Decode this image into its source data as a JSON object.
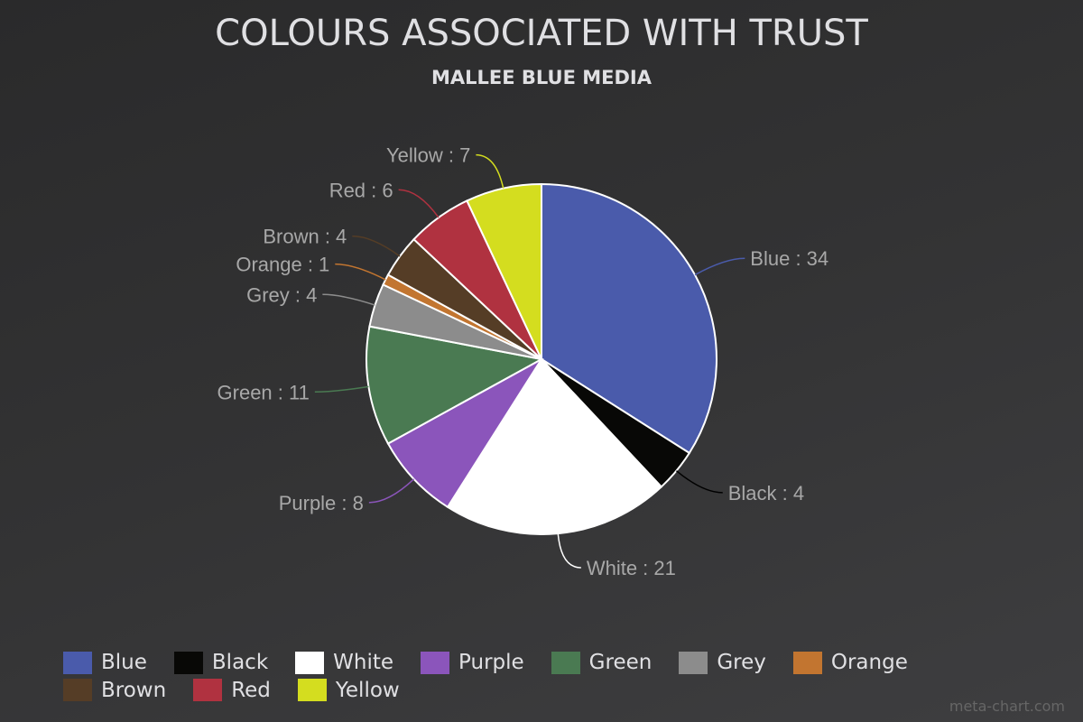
{
  "chart_data": {
    "type": "pie",
    "title": "COLOURS ASSOCIATED WITH TRUST",
    "subtitle": "MALLEE BLUE MEDIA",
    "categories": [
      "Blue",
      "Black",
      "White",
      "Purple",
      "Green",
      "Grey",
      "Orange",
      "Brown",
      "Red",
      "Yellow"
    ],
    "values": [
      34,
      4,
      21,
      8,
      11,
      4,
      1,
      4,
      6,
      7
    ],
    "colors": [
      "#4a5bab",
      "#080806",
      "#ffffff",
      "#8b55bb",
      "#4a7a52",
      "#8c8c8c",
      "#c27530",
      "#553d26",
      "#b03240",
      "#d4dd1f"
    ],
    "label_format": "{name} : {value}",
    "legend_position": "bottom"
  },
  "credit": "meta-chart.com"
}
